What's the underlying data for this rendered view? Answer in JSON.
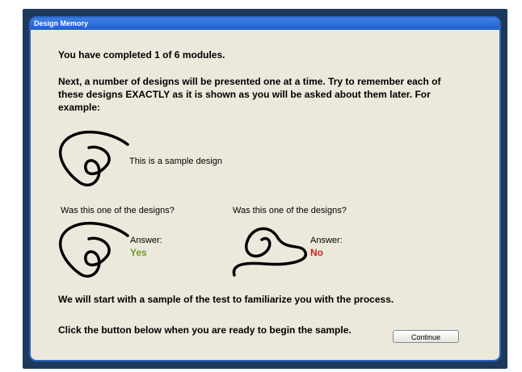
{
  "window": {
    "title": "Design Memory"
  },
  "main": {
    "progress_text": "You have completed 1 of 6 modules.",
    "instructions": "Next, a number of designs will be presented one at a time. Try to remember each of these designs EXACTLY as it is shown as you will be asked about them later. For example:",
    "sample_label": "This is a sample design",
    "example1": {
      "question": "Was this one of the designs?",
      "answer_label": "Answer:",
      "answer": "Yes",
      "answer_color": "#6a9a1f"
    },
    "example2": {
      "question": "Was this one of the designs?",
      "answer_label": "Answer:",
      "answer": "No",
      "answer_color": "#c4261d"
    },
    "sample_intro": "We will start with a sample of the test to familiarize you with the process.",
    "prompt": "Click the button below when you are ready to begin the sample.",
    "continue_label": "Continue"
  }
}
